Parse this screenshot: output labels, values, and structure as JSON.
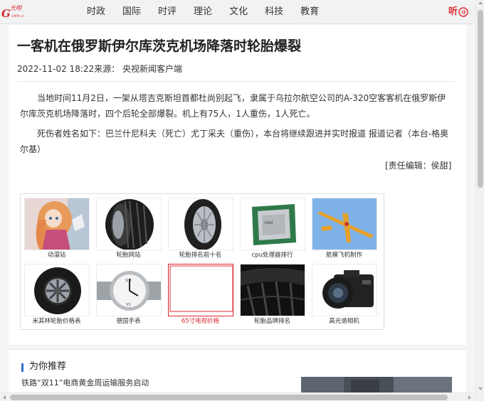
{
  "header": {
    "logo_text": "光明网",
    "logo_script": "光明",
    "logo_sub": "GMW.cn",
    "nav": [
      "时政",
      "国际",
      "时评",
      "理论",
      "文化",
      "科技",
      "教育"
    ],
    "listen_label": "听"
  },
  "article": {
    "title": "一客机在俄罗斯伊尔库茨克机场降落时轮胎爆裂",
    "meta": "2022-11-02 18:22来源： 央视新闻客户端",
    "paragraphs": [
      "当地时间11月2日，一架从塔吉克斯坦首都杜尚别起飞，隶属于乌拉尔航空公司的A-320空客客机在俄罗斯伊尔库茨克机场降落时，四个后轮全部爆裂。机上有75人，1人重伤，1人死亡。",
      "死伤者姓名如下：巴兰什尼科夫（死亡）尤丁采夫（重伤），本台将继续跟进并实时报道 报道记者（本台-格奥尔基）"
    ],
    "editor": "[责任编辑：侯甜]"
  },
  "ads": [
    {
      "caption": "动漫站",
      "icon": "anime-girl-image"
    },
    {
      "caption": "轮胎网站",
      "icon": "tire-tread-image"
    },
    {
      "caption": "轮胎排名前十名",
      "icon": "tire-image"
    },
    {
      "caption": "cpu处理器排行",
      "icon": "cpu-image"
    },
    {
      "caption": "航模飞机制作",
      "icon": "model-plane-image"
    },
    {
      "caption": "米其林轮胎价格表",
      "icon": "wheel-image"
    },
    {
      "caption": "德国手表",
      "icon": "watch-image"
    },
    {
      "caption": "65寸电视价格",
      "icon": "tv-image"
    },
    {
      "caption": "轮胎品牌排名",
      "icon": "tire-closeup-image"
    },
    {
      "caption": "高光谱相机",
      "icon": "camera-image"
    }
  ],
  "recommend": {
    "title": "为你推荐",
    "items": [
      "铁路“双11”电商黄金周运输服务启动"
    ]
  },
  "colors": {
    "brand_red": "#d9282f",
    "accent_blue": "#2e6fd2"
  }
}
